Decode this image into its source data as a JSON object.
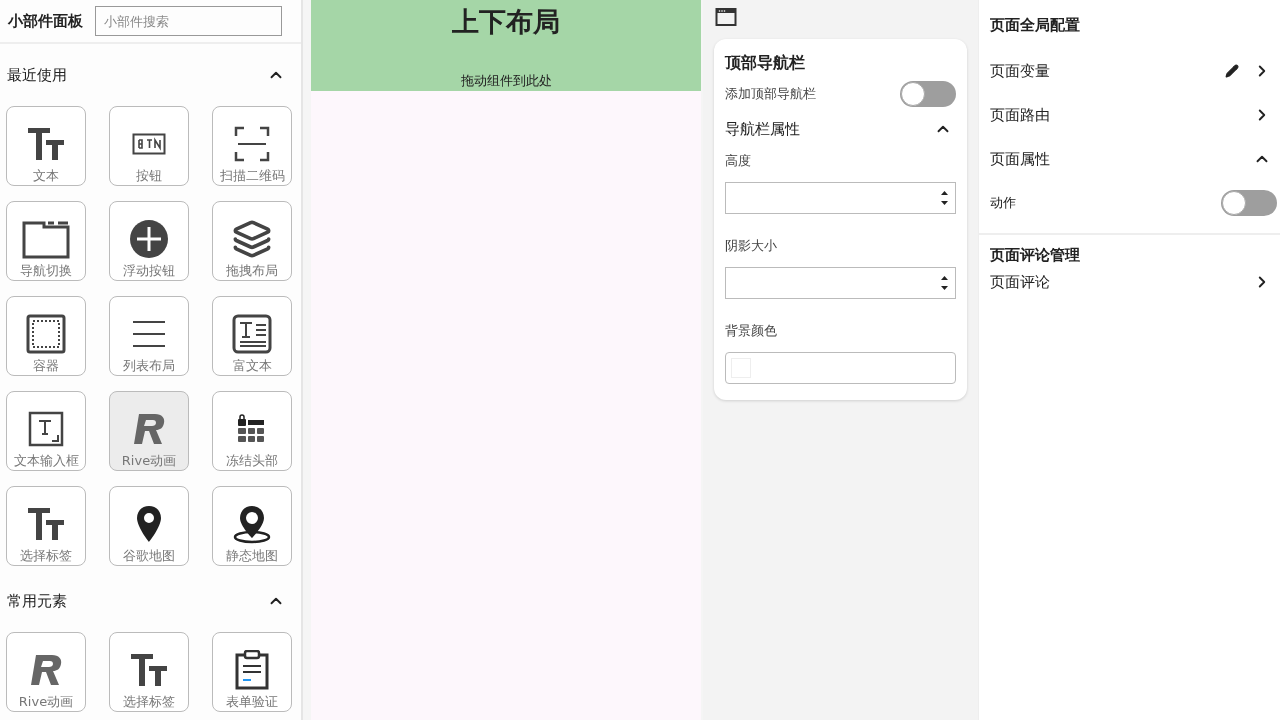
{
  "widget_panel": {
    "title": "小部件面板",
    "search": {
      "placeholder": "小部件搜索"
    },
    "sections": [
      {
        "title": "最近使用",
        "expanded": true,
        "items": [
          {
            "label": "文本",
            "kind": "text",
            "hovered": false
          },
          {
            "label": "按钮",
            "kind": "button",
            "hovered": false
          },
          {
            "label": "扫描二维码",
            "kind": "scan",
            "hovered": false
          },
          {
            "label": "导航切换",
            "kind": "tabs",
            "hovered": false
          },
          {
            "label": "浮动按钮",
            "kind": "fab",
            "hovered": false
          },
          {
            "label": "拖拽布局",
            "kind": "layers",
            "hovered": false
          },
          {
            "label": "容器",
            "kind": "container",
            "hovered": false
          },
          {
            "label": "列表布局",
            "kind": "list",
            "hovered": false
          },
          {
            "label": "富文本",
            "kind": "richtext",
            "hovered": false
          },
          {
            "label": "文本输入框",
            "kind": "input",
            "hovered": false
          },
          {
            "label": "Rive动画",
            "kind": "rive",
            "hovered": true
          },
          {
            "label": "冻结头部",
            "kind": "freeze",
            "hovered": false
          },
          {
            "label": "选择标签",
            "kind": "text",
            "hovered": false
          },
          {
            "label": "谷歌地图",
            "kind": "pin",
            "hovered": false
          },
          {
            "label": "静态地图",
            "kind": "mappin",
            "hovered": false
          }
        ]
      },
      {
        "title": "常用元素",
        "expanded": true,
        "items": [
          {
            "label": "Rive动画",
            "kind": "rive",
            "hovered": false
          },
          {
            "label": "选择标签",
            "kind": "text",
            "hovered": false
          },
          {
            "label": "表单验证",
            "kind": "form",
            "hovered": false
          }
        ]
      }
    ]
  },
  "canvas": {
    "title": "上下布局",
    "hint": "拖动组件到此处"
  },
  "nav_panel": {
    "title": "顶部导航栏",
    "toggle": {
      "label": "添加顶部导航栏",
      "on": false
    },
    "group": {
      "title": "导航栏属性",
      "expanded": true
    },
    "fields": [
      {
        "label": "高度",
        "kind": "number"
      },
      {
        "label": "阴影大小",
        "kind": "number"
      },
      {
        "label": "背景颜色",
        "kind": "color"
      }
    ]
  },
  "page_config": {
    "title": "页面全局配置",
    "rows": [
      {
        "label": "页面变量",
        "kind": "edit-link"
      },
      {
        "label": "页面路由",
        "kind": "link"
      },
      {
        "label": "页面属性",
        "kind": "group",
        "expanded": true
      },
      {
        "label": "动作",
        "kind": "switch",
        "on": false
      }
    ],
    "comments": {
      "title": "页面评论管理",
      "rows": [
        {
          "label": "页面评论",
          "kind": "link"
        }
      ]
    }
  }
}
